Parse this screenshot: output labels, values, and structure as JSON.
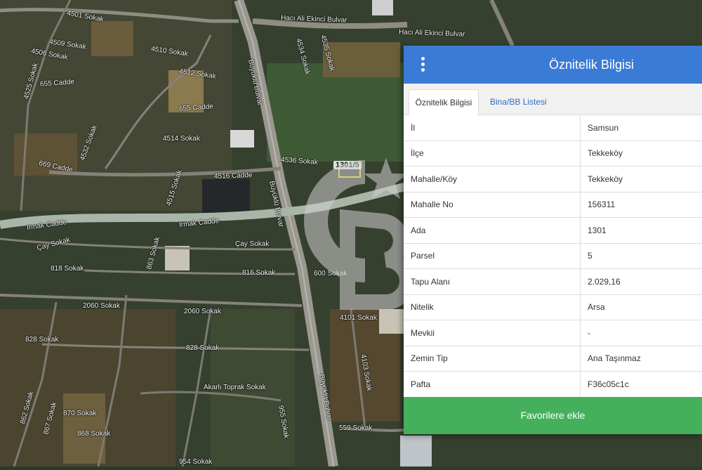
{
  "map": {
    "parcel_tag": "1301/5",
    "labels": [
      "Hacı Ali Ekinci Bulvar",
      "Hacı Ali Ekinci Bulvar",
      "Büyüklü Bulvar",
      "Büyüklü Bulvar",
      "Büyüklü Bulvar",
      "655 Cadde",
      "655 Cadde",
      "669 Cadde",
      "4516 Cadde",
      "Irmak Cadde",
      "Irmak Cadde",
      "4501 Sokak",
      "4509 Sokak",
      "4506 Sokak",
      "4510 Sokak",
      "4512 Sokak",
      "4514 Sokak",
      "4536 Sokak",
      "4534 Sokak",
      "4535 Sokak",
      "4532 Sokak",
      "4515 Sokak",
      "4525 Sokak",
      "Çay Sokak",
      "Çay Sokak",
      "818 Sokak",
      "816 Sokak",
      "863 Sokak",
      "2060 Sokak",
      "2060 Sokak",
      "828 Sokak",
      "828 Sokak",
      "870 Sokak",
      "868 Sokak",
      "867 Sokak",
      "862 Sokak",
      "4101 Sokak",
      "4103 Sokak",
      "559 Sokak",
      "955 Sokak",
      "600 Sokak",
      "Akarlı Toprak Sokak",
      "954 Sokak"
    ]
  },
  "panel": {
    "title": "Öznitelik Bilgisi",
    "tabs": [
      "Öznitelik Bilgisi",
      "Bina/BB Listesi"
    ],
    "rows": [
      {
        "key": "İl",
        "value": "Samsun"
      },
      {
        "key": "İlçe",
        "value": "Tekkeköy"
      },
      {
        "key": "Mahalle/Köy",
        "value": "Tekkeköy"
      },
      {
        "key": "Mahalle No",
        "value": "156311"
      },
      {
        "key": "Ada",
        "value": "1301"
      },
      {
        "key": "Parsel",
        "value": "5"
      },
      {
        "key": "Tapu Alanı",
        "value": "2.029,16"
      },
      {
        "key": "Nitelik",
        "value": "Arsa"
      },
      {
        "key": "Mevkii",
        "value": "-"
      },
      {
        "key": "Zemin Tip",
        "value": "Ana Taşınmaz"
      },
      {
        "key": "Pafta",
        "value": "F36c05c1c"
      }
    ],
    "button": "Favorilere ekle"
  },
  "colors": {
    "header": "#3a7bd5",
    "button": "#45b05c",
    "tab_link": "#2f6fbf"
  }
}
